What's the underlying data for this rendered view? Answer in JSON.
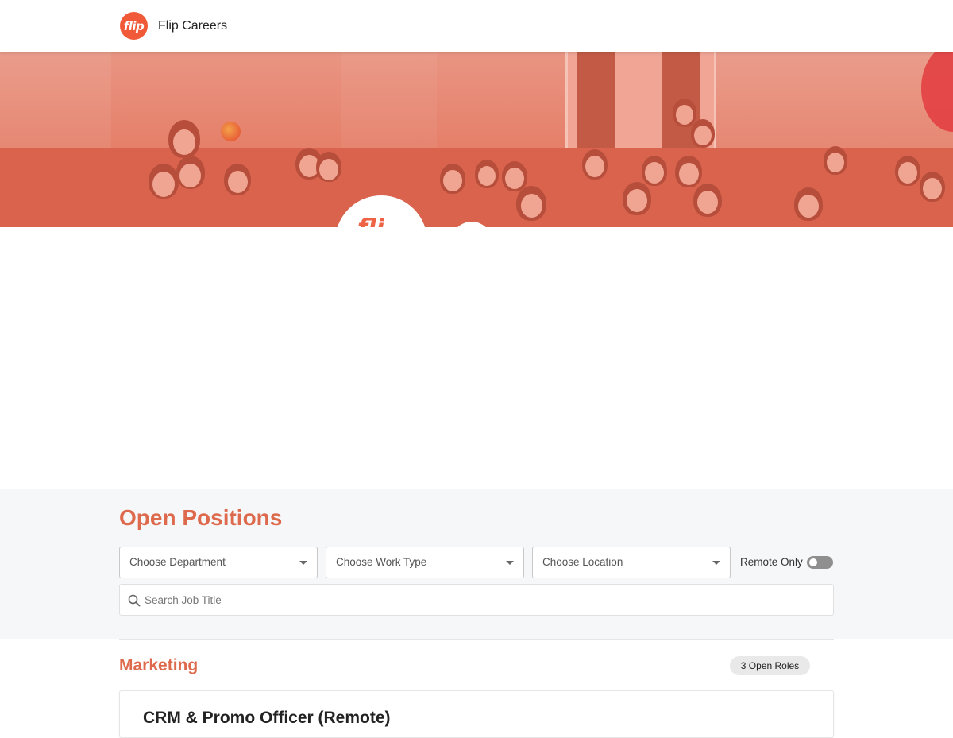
{
  "header": {
    "logo_text": "flip",
    "brand_name": "Flip Careers"
  },
  "hero": {
    "logo_text": "fli"
  },
  "open_positions": {
    "title": "Open Positions",
    "filters": {
      "department": "Choose Department",
      "work_type": "Choose Work Type",
      "location": "Choose Location",
      "remote_label": "Remote Only",
      "remote_enabled": false
    },
    "search_placeholder": "Search Job Title"
  },
  "departments": [
    {
      "name": "Marketing",
      "roles_badge": "3 Open Roles",
      "jobs": [
        {
          "title": "CRM & Promo Officer (Remote)"
        }
      ]
    }
  ],
  "colors": {
    "brand": "#f15a39",
    "accent_text": "#de6a4d",
    "hero_tint": "#e57f69",
    "filter_bg": "#f6f7f9"
  }
}
